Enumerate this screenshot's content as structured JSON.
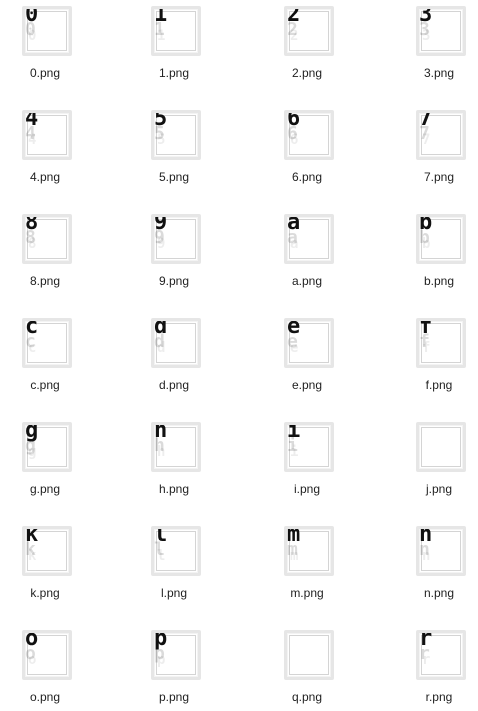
{
  "files": [
    {
      "name": "0.png",
      "glyph": "0"
    },
    {
      "name": "1.png",
      "glyph": "1"
    },
    {
      "name": "2.png",
      "glyph": "2"
    },
    {
      "name": "3.png",
      "glyph": "3"
    },
    {
      "name": "4.png",
      "glyph": "4"
    },
    {
      "name": "5.png",
      "glyph": "5"
    },
    {
      "name": "6.png",
      "glyph": "6"
    },
    {
      "name": "7.png",
      "glyph": "7"
    },
    {
      "name": "8.png",
      "glyph": "8"
    },
    {
      "name": "9.png",
      "glyph": "9"
    },
    {
      "name": "a.png",
      "glyph": "a"
    },
    {
      "name": "b.png",
      "glyph": "b"
    },
    {
      "name": "c.png",
      "glyph": "c"
    },
    {
      "name": "d.png",
      "glyph": "d"
    },
    {
      "name": "e.png",
      "glyph": "e"
    },
    {
      "name": "f.png",
      "glyph": "f"
    },
    {
      "name": "g.png",
      "glyph": "g"
    },
    {
      "name": "h.png",
      "glyph": "h"
    },
    {
      "name": "i.png",
      "glyph": "i"
    },
    {
      "name": "j.png",
      "glyph": ""
    },
    {
      "name": "k.png",
      "glyph": "k"
    },
    {
      "name": "l.png",
      "glyph": "l"
    },
    {
      "name": "m.png",
      "glyph": "m"
    },
    {
      "name": "n.png",
      "glyph": "n"
    },
    {
      "name": "o.png",
      "glyph": "o"
    },
    {
      "name": "p.png",
      "glyph": "p"
    },
    {
      "name": "q.png",
      "glyph": ""
    },
    {
      "name": "r.png",
      "glyph": "r"
    }
  ]
}
